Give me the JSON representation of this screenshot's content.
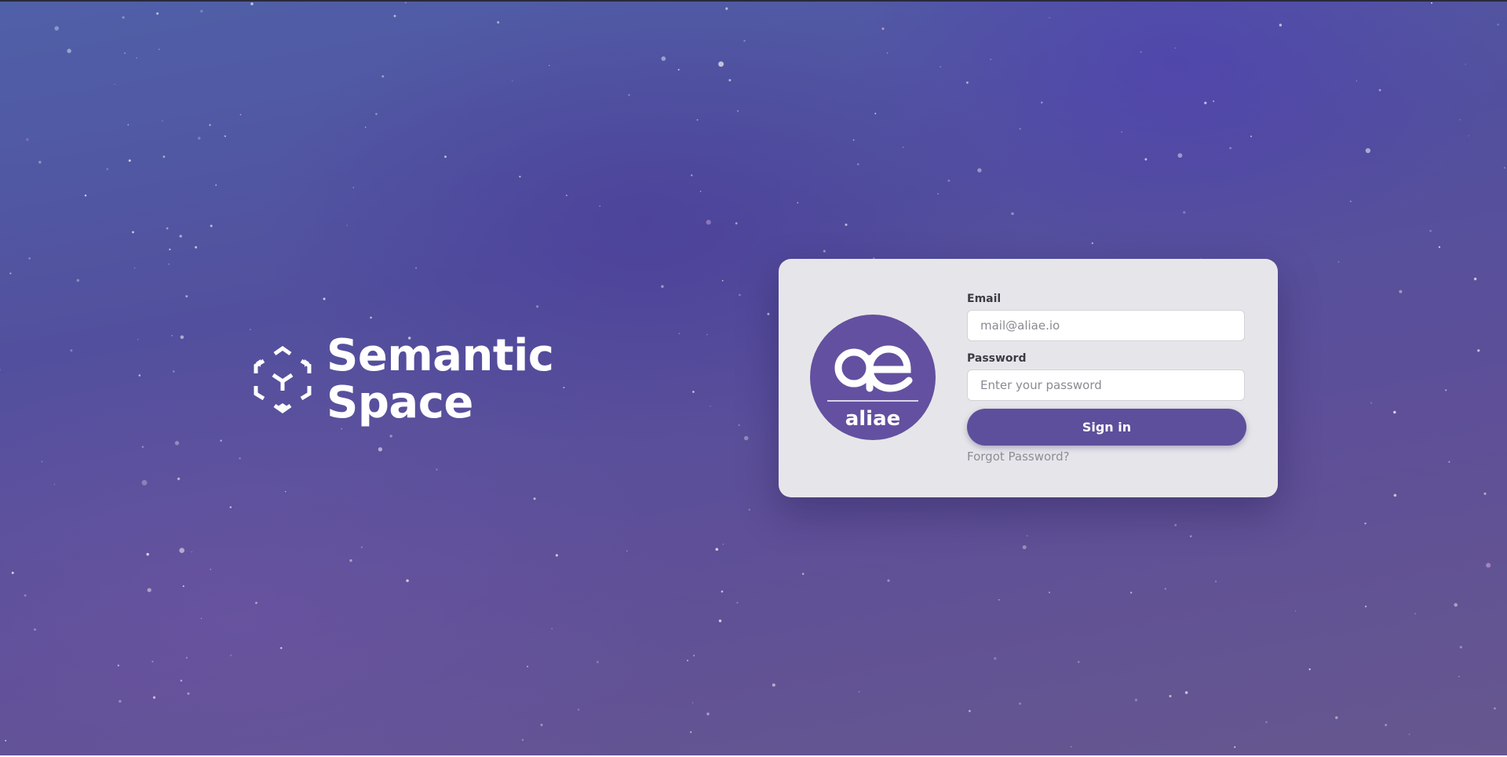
{
  "brand": {
    "name_line1": "Semantic",
    "name_line2": "Space",
    "logo_icon": "semantic-space-hexagon-logo"
  },
  "login_card": {
    "logo": {
      "icon": "aliae-logo",
      "glyph": "ae",
      "text": "aliae",
      "color": "#6350a0"
    },
    "email": {
      "label": "Email",
      "value": "",
      "placeholder": "mail@aliae.io"
    },
    "password": {
      "label": "Password",
      "value": "",
      "placeholder": "Enter your password"
    },
    "sign_in_label": "Sign in",
    "forgot_password_label": "Forgot Password?"
  },
  "colors": {
    "accent": "#5e4f9c",
    "card_background": "#e6e6ea",
    "background_top": "#5060a8",
    "background_bottom": "#66578f"
  }
}
